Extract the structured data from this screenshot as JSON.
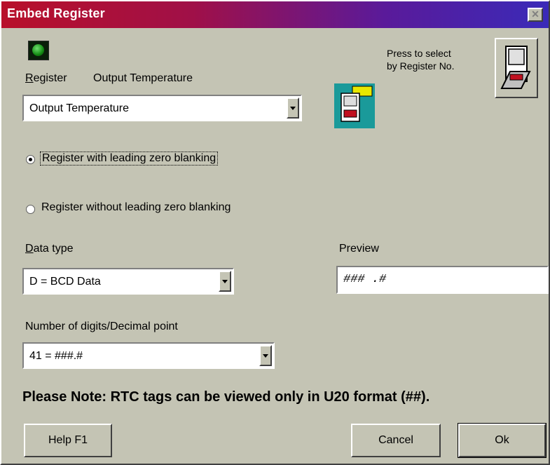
{
  "window": {
    "title": "Embed Register",
    "close_symbol": "✕"
  },
  "indicator": {
    "icon": "green-led-icon"
  },
  "register": {
    "label": "Register",
    "current_name": "Output Temperature",
    "select_value": "Output Temperature"
  },
  "select_by_number": {
    "line1": "Press to select",
    "line2": "by Register No."
  },
  "options": {
    "with_blanking": "Register with leading zero blanking",
    "without_blanking": "Register without leading zero blanking",
    "selected": "with_blanking"
  },
  "data_type": {
    "label": "Data type",
    "value": "D = BCD Data"
  },
  "preview": {
    "label": "Preview",
    "value": "### .#"
  },
  "digits": {
    "label": "Number of digits/Decimal point",
    "value": "41 = ###.#"
  },
  "note": "Please Note: RTC tags can be viewed only in U20 format (##).",
  "buttons": {
    "help": "Help  F1",
    "cancel": "Cancel",
    "ok": "Ok"
  },
  "colors": {
    "dialog_bg": "#c4c4b4",
    "title_start": "#b8102a",
    "title_end": "#3a2ab8"
  }
}
